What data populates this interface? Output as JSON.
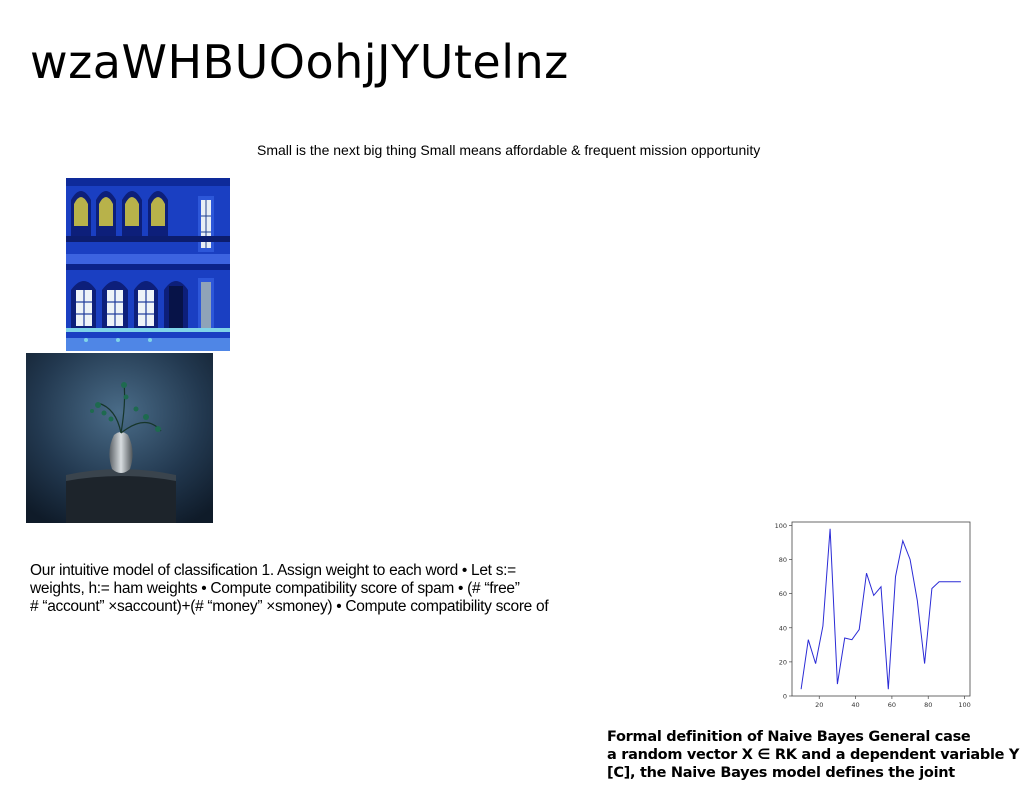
{
  "slide": {
    "title": "wzaWHBUOohjJYUtelnz",
    "subtitle": "Small is the next big thing Small means affordable & frequent mission opportunity",
    "images": {
      "building": "blue-building-facade",
      "vase": "vase-with-plant"
    },
    "body_lines": [
      "Our intuitive model of classification 1. Assign weight to each word • Let s:=",
      "weights, h:= ham weights • Compute compatibility score of spam • (# “free”",
      "# “account” ×saccount)+(# “money” ×smoney) • Compute compatibility score of"
    ],
    "formal_lines": [
      "Formal definition of Naive Bayes General case",
      "a random vector X ∈ RK and a dependent variable Y",
      "[C], the Naive Bayes model defines the joint"
    ]
  },
  "chart_data": {
    "type": "line",
    "title": "",
    "xlabel": "",
    "ylabel": "",
    "xlim": [
      5,
      103
    ],
    "ylim": [
      0,
      102
    ],
    "xticks": [
      20,
      40,
      60,
      80,
      100
    ],
    "yticks": [
      0,
      20,
      40,
      60,
      80,
      100
    ],
    "grid": false,
    "color": "#2b2bd6",
    "series": [
      {
        "x": [
          10,
          14,
          18,
          22,
          26,
          30,
          34,
          38,
          42,
          46,
          50,
          54,
          58,
          62,
          66,
          70,
          74,
          78,
          82,
          86,
          90,
          94,
          98
        ],
        "values": [
          4,
          33,
          19,
          41,
          98,
          7,
          34,
          33,
          39,
          72,
          59,
          64,
          4,
          70,
          91,
          80,
          56,
          19,
          63,
          67,
          67,
          67,
          67
        ]
      }
    ]
  }
}
